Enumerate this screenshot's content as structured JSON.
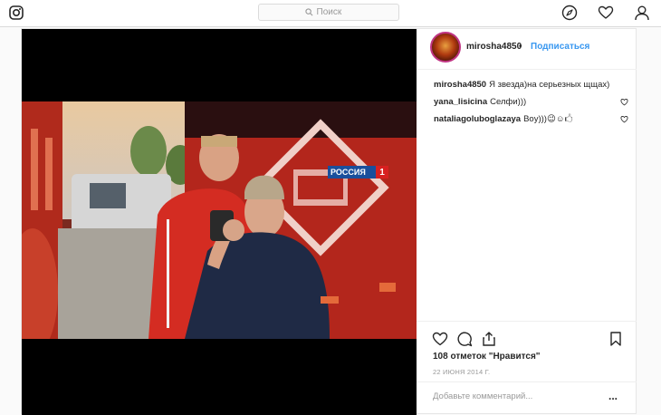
{
  "nav": {
    "search_placeholder": "Поиск"
  },
  "post": {
    "username": "mirosha4850",
    "separator": "•",
    "follow_label": "Подписаться",
    "channel_logo": "РОССИЯ",
    "channel_number": "1",
    "comments": [
      {
        "user": "mirosha4850",
        "text": "Я звезда)на серьезных щщах)"
      },
      {
        "user": "yana_lisicina",
        "text": "Селфи)))"
      },
      {
        "user": "nataliagoluboglazaya",
        "text": "Boy)))😉☺🖒"
      }
    ],
    "likes": "108 отметок \"Нравится\"",
    "date": "22 ИЮНЯ 2014 Г.",
    "add_comment_placeholder": "Добавьте комментарий...",
    "more_label": "..."
  },
  "colors": {
    "link": "#3897f0",
    "text": "#262626",
    "muted": "#999999",
    "border": "#dbdbdb"
  }
}
